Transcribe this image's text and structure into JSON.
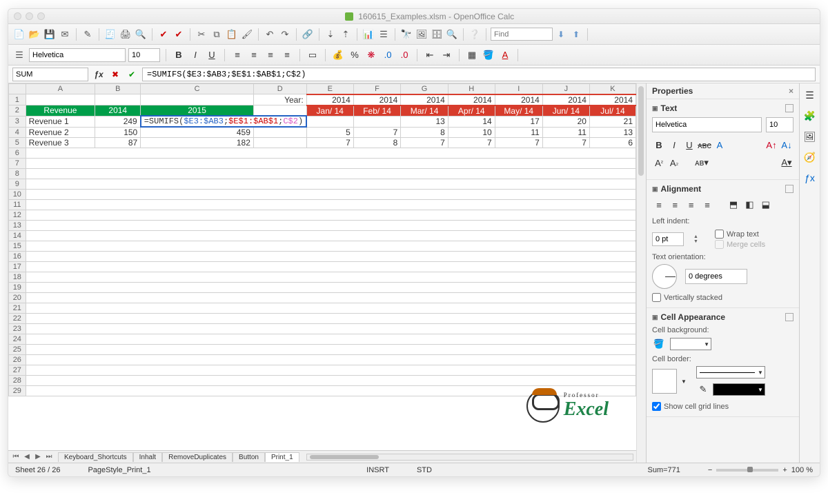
{
  "window_title": "160615_Examples.xlsm - OpenOffice Calc",
  "find_placeholder": "Find",
  "font_name": "Helvetica",
  "font_size": "10",
  "name_box": "SUM",
  "formula": "=SUMIFS($E3:$AB3;$E$1:$AB$1;C$2)",
  "cell_formula_prefix": "=SUMIFS(",
  "cell_formula_arg1": "$E3:$AB3",
  "cell_formula_sep1": ";",
  "cell_formula_arg2": "$E$1:$AB$1",
  "cell_formula_sep2": ";",
  "cell_formula_arg3": "C$2",
  "cell_formula_suffix": ")",
  "columns": [
    "A",
    "B",
    "C",
    "D",
    "E",
    "F",
    "G",
    "H",
    "I",
    "J",
    "K"
  ],
  "year_label": "Year:",
  "year_values": [
    "2014",
    "2014",
    "2014",
    "2014",
    "2014",
    "2014",
    "2014"
  ],
  "header_green_A": "Revenue",
  "header_green_B": "2014",
  "header_green_C": "2015",
  "header_red": [
    "Jan/ 14",
    "Feb/ 14",
    "Mar/ 14",
    "Apr/ 14",
    "May/ 14",
    "Jun/ 14",
    "Jul/ 14"
  ],
  "rows": [
    {
      "label": "Revenue 1",
      "b": "249",
      "e": "",
      "f": "",
      "g": "13",
      "h": "14",
      "i": "17",
      "j": "20",
      "k": "21"
    },
    {
      "label": "Revenue 2",
      "b": "150",
      "c": "459",
      "e": "5",
      "f": "7",
      "g": "8",
      "h": "10",
      "i": "11",
      "j": "11",
      "k": "13"
    },
    {
      "label": "Revenue 3",
      "b": "87",
      "c": "182",
      "e": "7",
      "f": "8",
      "g": "7",
      "h": "7",
      "i": "7",
      "j": "7",
      "k": "6"
    }
  ],
  "sheet_tabs": [
    "Keyboard_Shortcuts",
    "Inhalt",
    "RemoveDuplicates",
    "Button",
    "Print_1"
  ],
  "active_tab": "Print_1",
  "status_sheet": "Sheet 26 / 26",
  "status_style": "PageStyle_Print_1",
  "status_insrt": "INSRT",
  "status_std": "STD",
  "status_sum": "Sum=771",
  "zoom_pct": "100 %",
  "sidebar": {
    "title": "Properties",
    "text_label": "Text",
    "align_label": "Alignment",
    "indent_label": "Left indent:",
    "indent_value": "0 pt",
    "wrap_label": "Wrap text",
    "merge_label": "Merge cells",
    "orient_label": "Text orientation:",
    "deg_value": "0 degrees",
    "vstack_label": "Vertically stacked",
    "cellapp_label": "Cell Appearance",
    "cellbg_label": "Cell background:",
    "cellborder_label": "Cell border:",
    "gridlines_label": "Show cell grid lines"
  },
  "logo": {
    "prof": "Professor",
    "excel": "Excel"
  }
}
